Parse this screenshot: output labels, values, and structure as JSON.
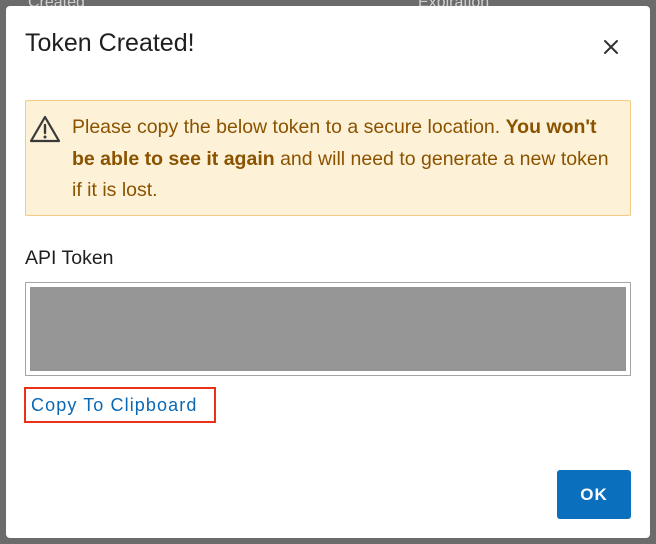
{
  "background": {
    "columns": [
      "Created",
      "Expiration"
    ]
  },
  "dialog": {
    "title": "Token Created!",
    "close_icon": "close-icon",
    "warning": {
      "icon": "warning-triangle-icon",
      "text_before": "Please copy the below token to a secure location. ",
      "text_bold": "You won't be able to see it again",
      "text_after": " and will need to generate a new token if it is lost."
    },
    "token_label": "API Token",
    "token_value": "",
    "copy_label": "Copy To Clipboard",
    "ok_label": "OK"
  },
  "colors": {
    "accent": "#0a6fbd",
    "link": "#0a68b4",
    "warning_bg": "#fdf1d7",
    "warning_text": "#8a5300",
    "highlight_border": "#e8321a"
  }
}
